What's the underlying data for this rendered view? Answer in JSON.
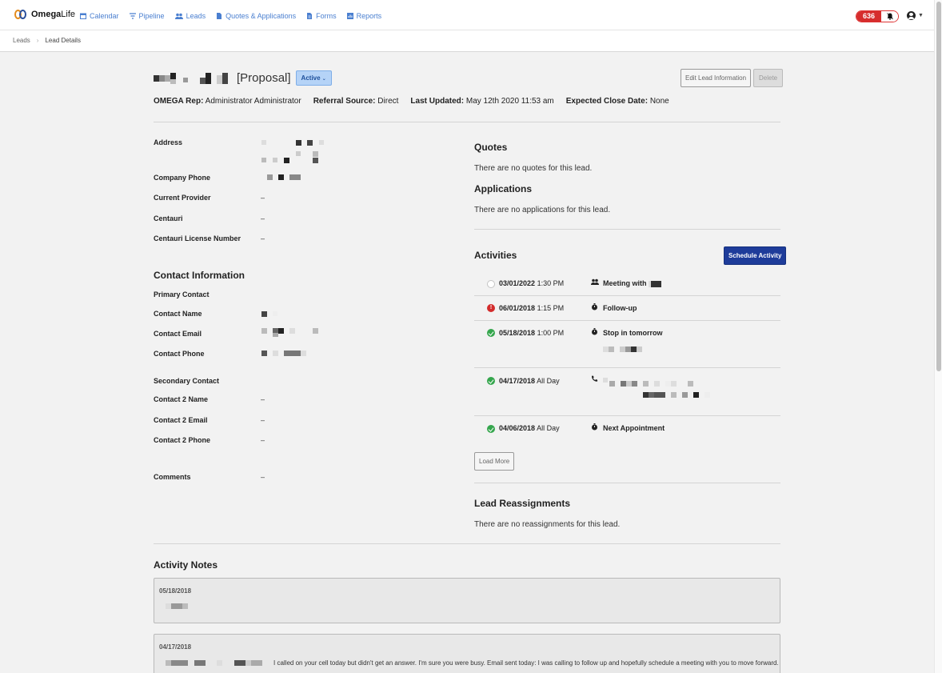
{
  "app": {
    "brand_strong": "Omega",
    "brand_light": "Life",
    "nav": [
      {
        "label": "Calendar",
        "icon": "calendar-icon"
      },
      {
        "label": "Pipeline",
        "icon": "funnel-icon"
      },
      {
        "label": "Leads",
        "icon": "users-icon"
      },
      {
        "label": "Quotes & Applications",
        "icon": "document-icon"
      },
      {
        "label": "Forms",
        "icon": "forms-icon"
      },
      {
        "label": "Reports",
        "icon": "chart-icon"
      }
    ],
    "notification_count": "636"
  },
  "breadcrumb": {
    "parent": "Leads",
    "current": "Lead Details"
  },
  "lead": {
    "title_suffix": "[Proposal]",
    "status": "Active",
    "edit_button": "Edit Lead Information",
    "delete_button": "Delete",
    "meta": [
      {
        "label": "OMEGA Rep:",
        "value": "Administrator Administrator"
      },
      {
        "label": "Referral Source:",
        "value": "Direct"
      },
      {
        "label": "Last Updated:",
        "value": "May 12th 2020 11:53 am"
      },
      {
        "label": "Expected Close Date:",
        "value": "None"
      }
    ]
  },
  "details": {
    "address_label": "Address",
    "company_phone_label": "Company Phone",
    "current_provider_label": "Current Provider",
    "current_provider_value": "–",
    "centauri_label": "Centauri",
    "centauri_value": "–",
    "centauri_license_label": "Centauri License Number",
    "centauri_license_value": "–"
  },
  "contact": {
    "heading": "Contact Information",
    "primary_heading": "Primary Contact",
    "name_label": "Contact Name",
    "email_label": "Contact Email",
    "phone_label": "Contact Phone",
    "secondary_heading": "Secondary Contact",
    "name2_label": "Contact 2 Name",
    "name2_value": "–",
    "email2_label": "Contact 2 Email",
    "email2_value": "–",
    "phone2_label": "Contact 2 Phone",
    "phone2_value": "–",
    "comments_label": "Comments",
    "comments_value": "–"
  },
  "quotes": {
    "heading": "Quotes",
    "empty": "There are no quotes for this lead."
  },
  "applications": {
    "heading": "Applications",
    "empty": "There are no applications for this lead."
  },
  "activities": {
    "heading": "Activities",
    "schedule_button": "Schedule Activity",
    "load_more": "Load More",
    "items": [
      {
        "date": "03/01/2022",
        "time": "1:30 PM",
        "title": "Meeting with",
        "status": "pending",
        "icon": "users-icon"
      },
      {
        "date": "06/01/2018",
        "time": "1:15 PM",
        "title": "Follow-up",
        "status": "overdue",
        "icon": "stopwatch-icon"
      },
      {
        "date": "05/18/2018",
        "time": "1:00 PM",
        "title": "Stop in tomorrow",
        "status": "done",
        "icon": "stopwatch-icon"
      },
      {
        "date": "04/17/2018",
        "time": "All Day",
        "title": "",
        "status": "done",
        "icon": "phone-icon"
      },
      {
        "date": "04/06/2018",
        "time": "All Day",
        "title": "Next Appointment",
        "status": "done",
        "icon": "stopwatch-icon"
      }
    ]
  },
  "reassignments": {
    "heading": "Lead Reassignments",
    "empty": "There are no reassignments for this lead."
  },
  "notes": {
    "heading": "Activity Notes",
    "items": [
      {
        "date": "05/18/2018",
        "text": ""
      },
      {
        "date": "04/17/2018",
        "text": "I called on your cell today but didn't get an answer. I'm sure you were busy. Email sent today: I was calling to follow up and hopefully schedule a meeting with you to move forward."
      }
    ]
  },
  "colors": {
    "primary": "#1e3c9a",
    "link": "#4a7fd0",
    "danger": "#d62d2d",
    "success": "#35a64d",
    "status_pill": "#b5d3f7"
  }
}
